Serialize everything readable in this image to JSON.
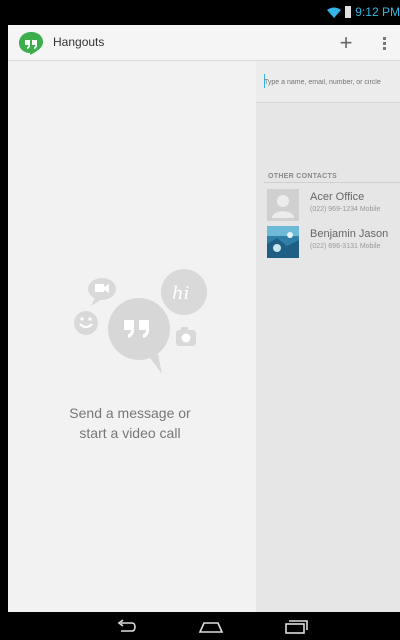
{
  "status_bar": {
    "time": "9:12 PM",
    "icons": [
      "wifi-icon",
      "battery-icon"
    ]
  },
  "app": {
    "title": "Hangouts"
  },
  "actionbar": {
    "actions": [
      "plus-icon",
      "overflow-menu-icon"
    ]
  },
  "empty_state": {
    "line1": "Send a message or",
    "line2": "start a video call",
    "art_text": "hi"
  },
  "search": {
    "placeholder": "Type a name, email, number, or circle"
  },
  "contacts_section": {
    "header": "OTHER CONTACTS",
    "items": [
      {
        "name": "Acer Office",
        "detail": "(022) 969-1234 Mobile"
      },
      {
        "name": "Benjamin Jason",
        "detail": "(022) 696-3131 Mobile"
      }
    ]
  },
  "navbar": {
    "buttons": [
      "back-icon",
      "home-icon",
      "recent-apps-icon"
    ]
  },
  "colors": {
    "accent": "#33b5e5",
    "hangouts_green": "#3cae4c"
  }
}
